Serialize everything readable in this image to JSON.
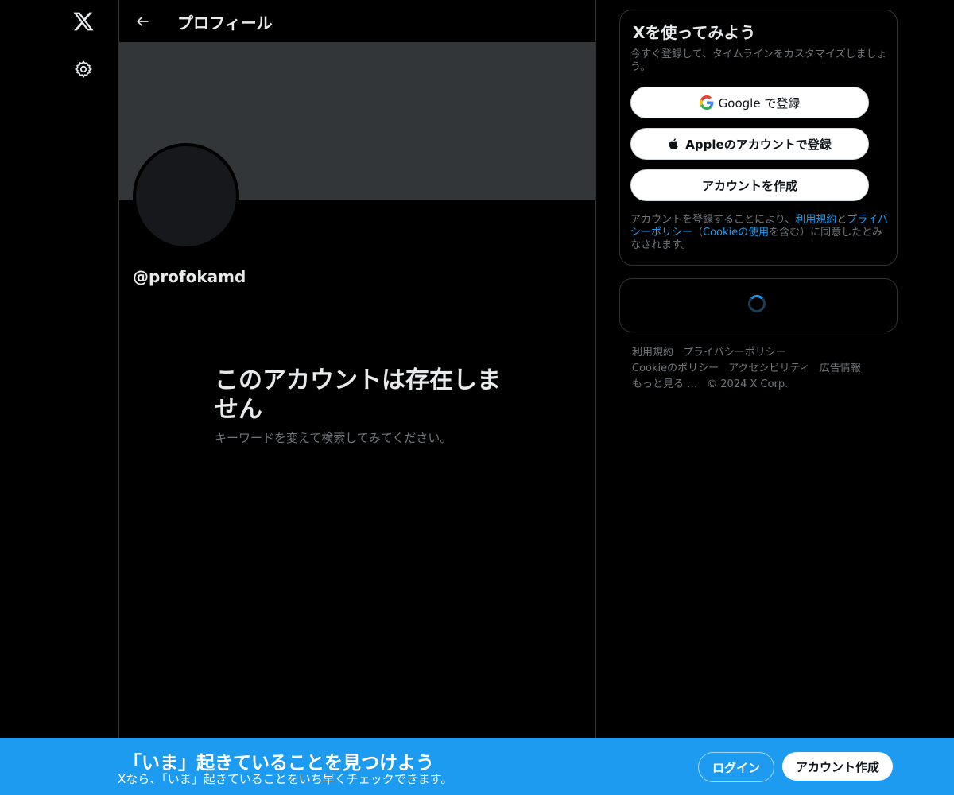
{
  "nav": {
    "logo_icon": "x-logo-icon",
    "settings_icon": "gear-icon"
  },
  "header": {
    "back_icon": "arrow-left-icon",
    "title": "プロフィール"
  },
  "profile": {
    "handle": "@profokamd",
    "empty_title": "このアカウントは存在しません",
    "empty_subtitle": "キーワードを変えて検索してみてください。"
  },
  "signup": {
    "title": "Xを使ってみよう",
    "subtitle": "今すぐ登録して、タイムラインをカスタマイズしましょう。",
    "google_label": "Google で登録",
    "apple_label": "Appleのアカウントで登録",
    "create_label": "アカウントを作成",
    "legal_prefix": "アカウントを登録することにより、",
    "legal_terms": "利用規約",
    "legal_and": "と",
    "legal_privacy": "プライバシーポリシー",
    "legal_paren_open": "（",
    "legal_cookie": "Cookieの使用",
    "legal_suffix": "を含む）に同意したとみなされます。"
  },
  "footer": {
    "terms": "利用規約",
    "privacy": "プライバシーポリシー",
    "cookie": "Cookieのポリシー",
    "accessibility": "アクセシビリティ",
    "ads": "広告情報",
    "more": "もっと見る …",
    "copyright": "© 2024 X Corp."
  },
  "bottom_bar": {
    "title": "「いま」起きていることを見つけよう",
    "subtitle": "Xなら、「いま」起きていることをいち早くチェックできます。",
    "login_label": "ログイン",
    "create_label": "アカウント作成"
  },
  "colors": {
    "accent": "#1d9bf0",
    "banner": "#333639",
    "background": "#000000"
  }
}
